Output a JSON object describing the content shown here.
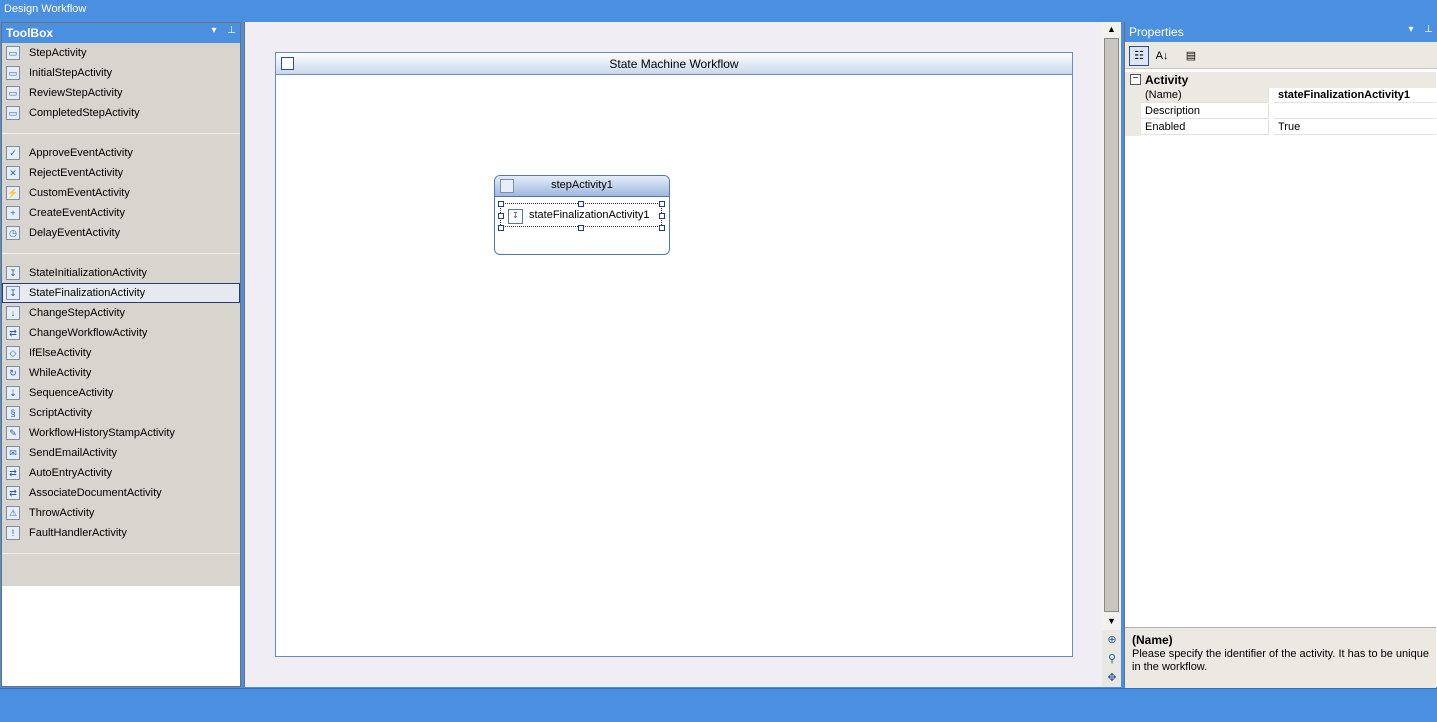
{
  "window": {
    "title": "Design Workflow"
  },
  "toolbox": {
    "title": "ToolBox",
    "pin_glyph": "⊥",
    "dropdown_glyph": "▾",
    "groups": [
      {
        "items": [
          {
            "label": "StepActivity",
            "icon": "step-icon",
            "glyph": "▭"
          },
          {
            "label": "InitialStepActivity",
            "icon": "initial-step-icon",
            "glyph": "▭"
          },
          {
            "label": "ReviewStepActivity",
            "icon": "review-step-icon",
            "glyph": "▭"
          },
          {
            "label": "CompletedStepActivity",
            "icon": "completed-step-icon",
            "glyph": "▭"
          }
        ]
      },
      {
        "items": [
          {
            "label": "ApproveEventActivity",
            "icon": "approve-event-icon",
            "glyph": "✓"
          },
          {
            "label": "RejectEventActivity",
            "icon": "reject-event-icon",
            "glyph": "✕"
          },
          {
            "label": "CustomEventActivity",
            "icon": "custom-event-icon",
            "glyph": "⚡"
          },
          {
            "label": "CreateEventActivity",
            "icon": "create-event-icon",
            "glyph": "+"
          },
          {
            "label": "DelayEventActivity",
            "icon": "delay-event-icon",
            "glyph": "◷"
          }
        ]
      },
      {
        "items": [
          {
            "label": "StateInitializationActivity",
            "icon": "state-initialization-icon",
            "glyph": "↧"
          },
          {
            "label": "StateFinalizationActivity",
            "icon": "state-finalization-icon",
            "glyph": "↧",
            "selected": true
          },
          {
            "label": "ChangeStepActivity",
            "icon": "change-step-icon",
            "glyph": "↓"
          },
          {
            "label": "ChangeWorkflowActivity",
            "icon": "change-workflow-icon",
            "glyph": "⇄"
          },
          {
            "label": "IfElseActivity",
            "icon": "if-else-icon",
            "glyph": "◇"
          },
          {
            "label": "WhileActivity",
            "icon": "while-icon",
            "glyph": "↻"
          },
          {
            "label": "SequenceActivity",
            "icon": "sequence-icon",
            "glyph": "⇣"
          },
          {
            "label": "ScriptActivity",
            "icon": "script-icon",
            "glyph": "§"
          },
          {
            "label": "WorkflowHistoryStampActivity",
            "icon": "history-stamp-icon",
            "glyph": "✎"
          },
          {
            "label": "SendEmailActivity",
            "icon": "send-email-icon",
            "glyph": "✉"
          },
          {
            "label": "AutoEntryActivity",
            "icon": "auto-entry-icon",
            "glyph": "⇄"
          },
          {
            "label": "AssociateDocumentActivity",
            "icon": "associate-document-icon",
            "glyph": "⇄"
          },
          {
            "label": "ThrowActivity",
            "icon": "throw-icon",
            "glyph": "⚠"
          },
          {
            "label": "FaultHandlerActivity",
            "icon": "fault-handler-icon",
            "glyph": "!"
          }
        ]
      }
    ]
  },
  "designer": {
    "workflow_title": "State Machine Workflow",
    "step": {
      "title": "stepActivity1",
      "child_label": "stateFinalizationActivity1",
      "child_glyph": "↧"
    },
    "scroll_up_glyph": "▲",
    "scroll_down_glyph": "▼",
    "side_tools": [
      {
        "icon": "zoom-icon",
        "glyph": "⊕"
      },
      {
        "icon": "find-icon",
        "glyph": "⚲"
      },
      {
        "icon": "pan-icon",
        "glyph": "✥"
      }
    ]
  },
  "properties": {
    "title": "Properties",
    "toolbar": [
      {
        "icon": "categorized-icon",
        "glyph": "☷",
        "active": true
      },
      {
        "icon": "alphabetical-icon",
        "glyph": "A↓",
        "active": false
      },
      {
        "icon": "property-pages-icon",
        "glyph": "▤",
        "active": false
      }
    ],
    "category": {
      "label": "Activity",
      "toggle": "−"
    },
    "rows": [
      {
        "key": "(Name)",
        "value": "stateFinalizationActivity1",
        "bold": true
      },
      {
        "key": "Description",
        "value": ""
      },
      {
        "key": "Enabled",
        "value": "True"
      }
    ],
    "help": {
      "title": "(Name)",
      "text": "Please specify the identifier of the activity. It has to be unique in the workflow."
    }
  },
  "colors": {
    "chrome_blue": "#4a8fe0",
    "toolbox_bg": "#d8d5cf",
    "selection_border": "#2b3b6a"
  }
}
